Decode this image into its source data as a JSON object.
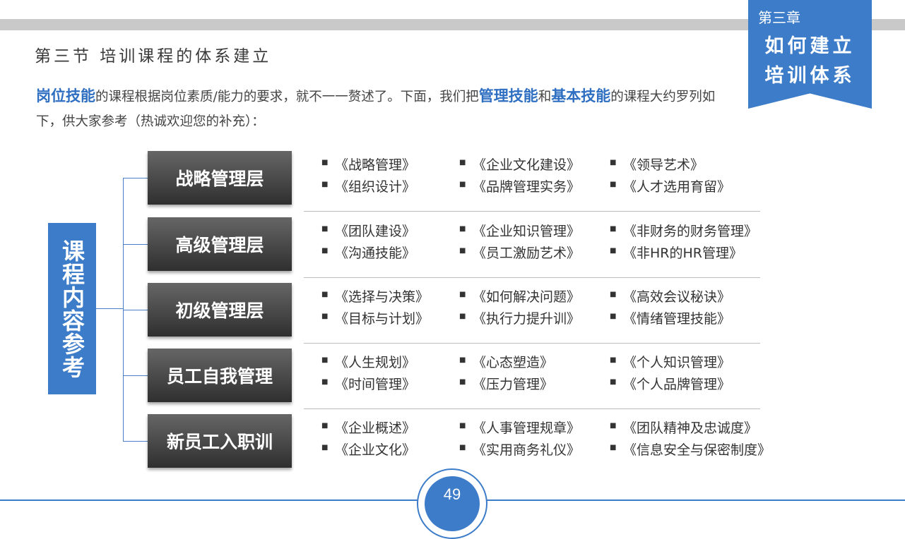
{
  "chapter": {
    "number": "第三章",
    "line1": "如何建立",
    "line2": "培训体系"
  },
  "section_title": "第三节  培训课程的体系建立",
  "intro": {
    "hl1": "岗位技能",
    "t1": "的课程根据岗位素质/能力的要求，就不一一赘述了。下面，我们把",
    "hl2": "管理技能",
    "t2": "和",
    "hl3": "基本技能",
    "t3": "的课程大约罗列如下，供大家参考（热诚欢迎您的补充）："
  },
  "left_label": "课程内容参考",
  "levels": [
    {
      "name": "战略管理层",
      "courses": [
        [
          "《战略管理》",
          "《组织设计》"
        ],
        [
          "《企业文化建设》",
          "《品牌管理实务》"
        ],
        [
          "《领导艺术》",
          "《人才选用育留》"
        ]
      ]
    },
    {
      "name": "高级管理层",
      "courses": [
        [
          "《团队建设》",
          "《沟通技能》"
        ],
        [
          "《企业知识管理》",
          "《员工激励艺术》"
        ],
        [
          "《非财务的财务管理》",
          "《非HR的HR管理》"
        ]
      ]
    },
    {
      "name": "初级管理层",
      "courses": [
        [
          "《选择与决策》",
          "《目标与计划》"
        ],
        [
          "《如何解决问题》",
          "《执行力提升训》"
        ],
        [
          "《高效会议秘诀》",
          "《情绪管理技能》"
        ]
      ]
    },
    {
      "name": "员工自我管理",
      "courses": [
        [
          "《人生规划》",
          "《时间管理》"
        ],
        [
          "《心态塑造》",
          "《压力管理》"
        ],
        [
          "《个人知识管理》",
          "《个人品牌管理》"
        ]
      ]
    },
    {
      "name": "新员工入职训",
      "courses": [
        [
          "《企业概述》",
          "《企业文化》"
        ],
        [
          "《人事管理规章》",
          "《实用商务礼仪》"
        ],
        [
          "《团队精神及忠诚度》",
          "《信息安全与保密制度》"
        ]
      ]
    }
  ],
  "page_number": "49",
  "colors": {
    "accent": "#3d7cc9",
    "level_box": "#3f3f3f"
  }
}
